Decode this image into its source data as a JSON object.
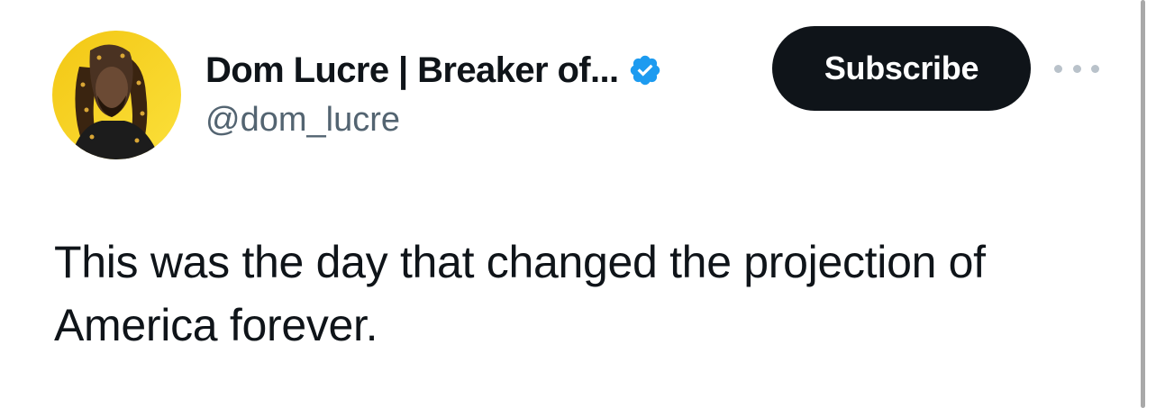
{
  "author": {
    "display_name": "Dom Lucre | Breaker of...",
    "handle": "@dom_lucre",
    "verified": true,
    "avatar_icon": "profile-photo"
  },
  "actions": {
    "subscribe_label": "Subscribe",
    "more_icon": "ellipsis-icon"
  },
  "tweet": {
    "text": "This was the day that changed the projection of America forever."
  },
  "colors": {
    "text_primary": "#0f1419",
    "text_secondary": "#536471",
    "verified_blue": "#1d9bf0",
    "button_bg": "#0f1419",
    "button_text": "#ffffff",
    "avatar_bg": "#f7d21e"
  }
}
